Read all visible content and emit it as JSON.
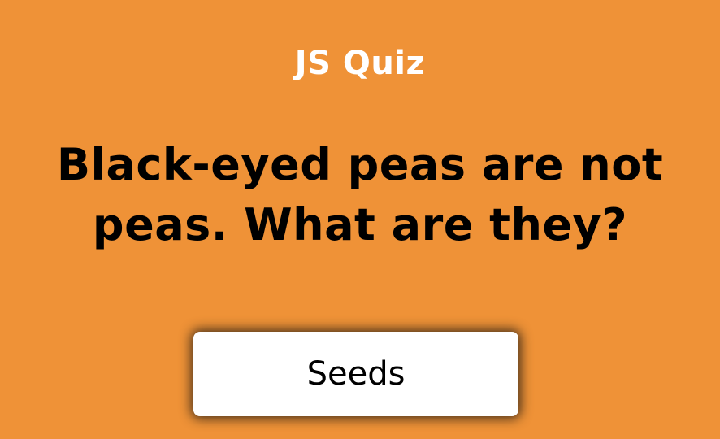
{
  "app": {
    "title": "JS Quiz"
  },
  "quiz": {
    "question": "Black-eyed peas are not peas. What are they?",
    "answers": [
      {
        "label": "Seeds"
      }
    ]
  },
  "colors": {
    "background": "#ef9237",
    "title_text": "#ffffff",
    "question_text": "#000000",
    "button_background": "#ffffff"
  }
}
